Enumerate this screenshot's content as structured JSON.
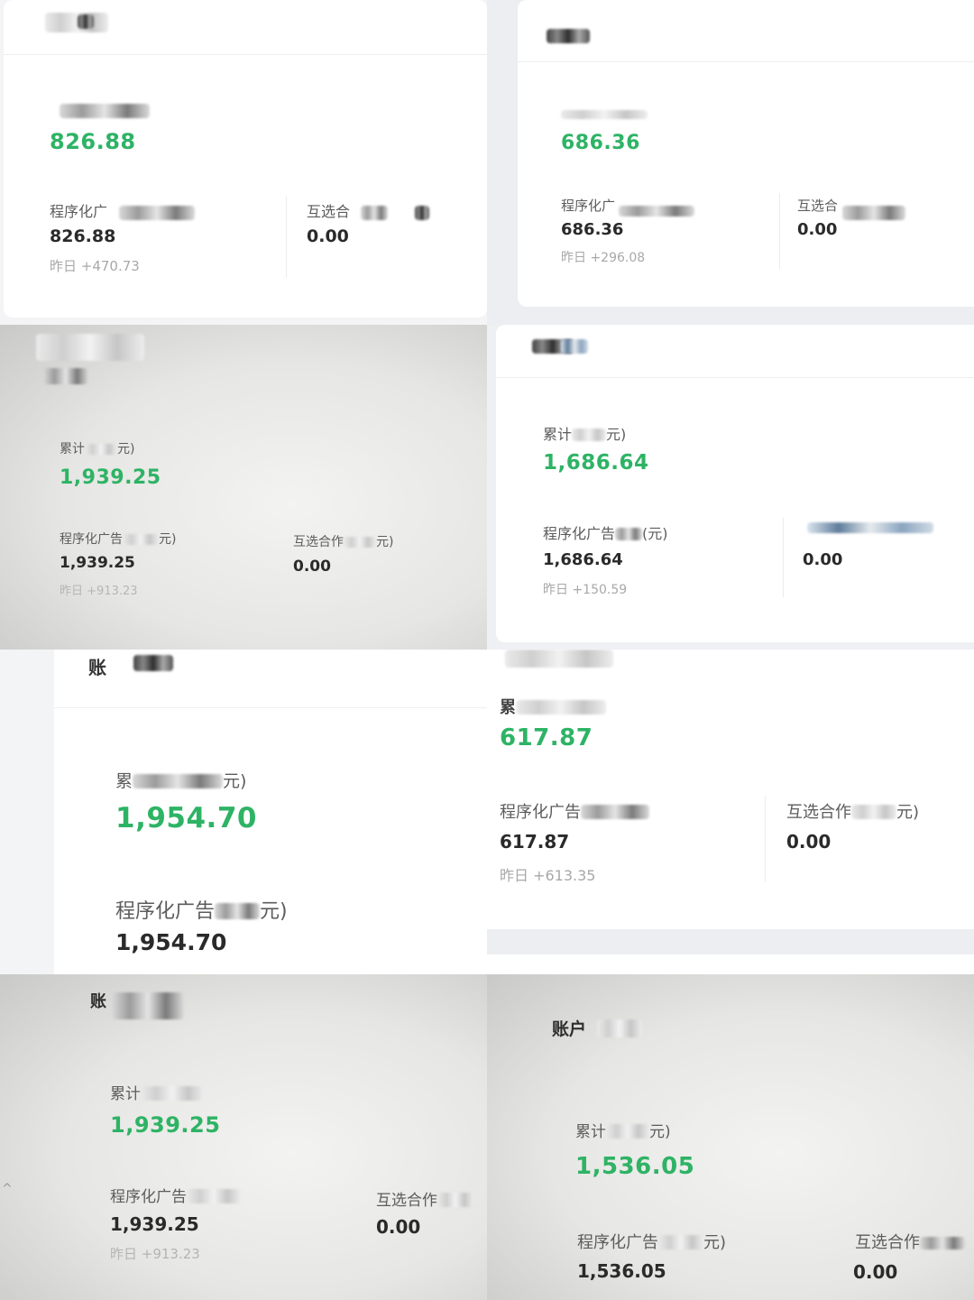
{
  "tiles": [
    {
      "header": "",
      "total_label": "",
      "total": "826.88",
      "prog_label": "程序化广",
      "prog_value": "826.88",
      "prog_yesterday": "昨日 +470.73",
      "mutual_label": "互选合",
      "mutual_value": "0.00"
    },
    {
      "header": "",
      "total_label": "",
      "total": "686.36",
      "prog_label": "程序化广",
      "prog_value": "686.36",
      "prog_yesterday": "昨日 +296.08",
      "mutual_label": "互选合",
      "mutual_value": "0.00"
    },
    {
      "header": "",
      "total_label": "累计",
      "total_label_tail": "元)",
      "total": "1,939.25",
      "prog_label": "程序化广告",
      "prog_label_tail": "元)",
      "prog_value": "1,939.25",
      "prog_yesterday": "昨日 +913.23",
      "mutual_label": "互选合作",
      "mutual_label_tail": "元)",
      "mutual_value": "0.00"
    },
    {
      "header": "",
      "total_label": "累计",
      "total_label_tail": "元)",
      "total": "1,686.64",
      "prog_label": "程序化广告",
      "prog_label_tail": "(元)",
      "prog_value": "1,686.64",
      "prog_yesterday": "昨日 +150.59",
      "mutual_label": "",
      "mutual_value": "0.00"
    },
    {
      "header": "账",
      "total_label": "累",
      "total_label_tail": "元)",
      "total": "1,954.70",
      "prog_label": "程序化广告",
      "prog_label_tail": "元)",
      "prog_value": "1,954.70"
    },
    {
      "total_label": "累",
      "total": "617.87",
      "prog_label": "程序化广告",
      "prog_value": "617.87",
      "prog_yesterday": "昨日 +613.35",
      "mutual_label": "互选合作",
      "mutual_label_tail": "元)",
      "mutual_value": "0.00"
    },
    {
      "header": "账",
      "total_label": "累计",
      "total": "1,939.25",
      "prog_label": "程序化广告",
      "prog_value": "1,939.25",
      "prog_yesterday": "昨日 +913.23",
      "mutual_label": "互选合作",
      "mutual_value": "0.00"
    },
    {
      "header": "账户",
      "total_label": "累计",
      "total_label_tail": "元)",
      "total": "1,536.05",
      "prog_label": "程序化广告",
      "prog_label_tail": "元)",
      "prog_value": "1,536.05",
      "mutual_label": "互选合作",
      "mutual_value": "0.00"
    }
  ],
  "colors": {
    "green": "#2eb365",
    "text_dark": "#2a2a2a",
    "text_label": "#5c5c5c",
    "text_sub": "#a8a8a8"
  }
}
